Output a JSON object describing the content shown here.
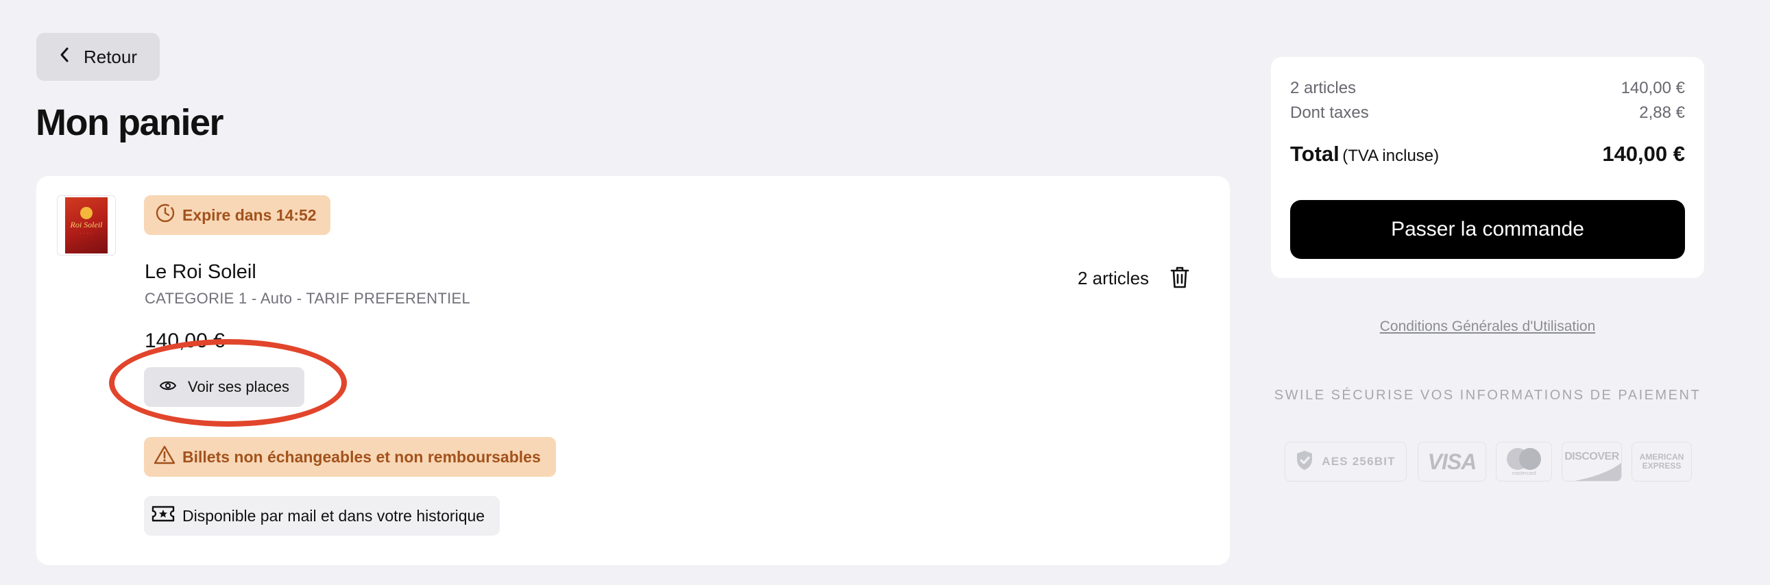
{
  "header": {
    "back_label": "Retour",
    "page_title": "Mon panier"
  },
  "cart_item": {
    "poster_title": "Roi Soleil",
    "expire_text": "Expire dans 14:52",
    "title": "Le Roi Soleil",
    "subtitle": "CATEGORIE 1 - Auto - TARIF PREFERENTIEL",
    "quantity_text": "2 articles",
    "price": "140,00 €",
    "see_seats_label": "Voir ses places",
    "warning_text": "Billets non échangeables et non remboursables",
    "availability_text": "Disponible par mail et dans votre historique"
  },
  "summary": {
    "articles_label": "2 articles",
    "articles_amount": "140,00 €",
    "taxes_label": "Dont taxes",
    "taxes_amount": "2,88 €",
    "total_label": "Total",
    "total_sub": "(TVA incluse)",
    "total_amount": "140,00 €",
    "order_button": "Passer la commande"
  },
  "footer": {
    "cgu_link": "Conditions Générales d'Utilisation",
    "secure_text": "SWILE SÉCURISE VOS INFORMATIONS DE PAIEMENT",
    "payment_logos": {
      "aes": "AES 256BIT",
      "visa": "VISA",
      "mastercard": "mastercard",
      "discover": "DISCOVER",
      "amex_line1": "AMERICAN",
      "amex_line2": "EXPRESS"
    }
  },
  "colors": {
    "background": "#f2f2f6",
    "badge_orange_bg": "#f8d7b6",
    "badge_orange_text": "#a2521c",
    "highlight_circle": "#e1452b",
    "primary_button": "#000000"
  }
}
